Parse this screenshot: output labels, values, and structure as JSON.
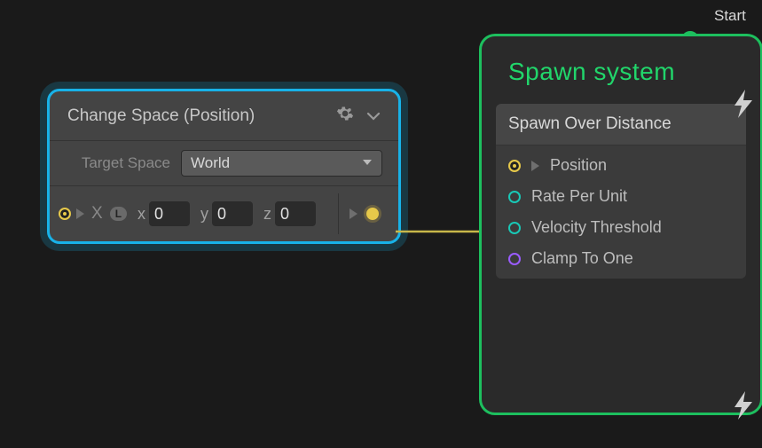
{
  "start_label": "Start",
  "change_space": {
    "title": "Change Space (Position)",
    "target_space_label": "Target Space",
    "target_space_value": "World",
    "vector_label": "X",
    "local_badge": "L",
    "fields": {
      "x_label": "x",
      "x_value": "0",
      "y_label": "y",
      "y_value": "0",
      "z_label": "z",
      "z_value": "0"
    }
  },
  "spawn": {
    "title": "Spawn system",
    "subheader": "Spawn Over Distance",
    "rows": [
      {
        "port": "yellow-dot",
        "play": true,
        "label": "Position"
      },
      {
        "port": "teal",
        "play": false,
        "label": "Rate Per Unit"
      },
      {
        "port": "teal",
        "play": false,
        "label": "Velocity Threshold"
      },
      {
        "port": "purple",
        "play": false,
        "label": "Clamp To One"
      }
    ]
  }
}
